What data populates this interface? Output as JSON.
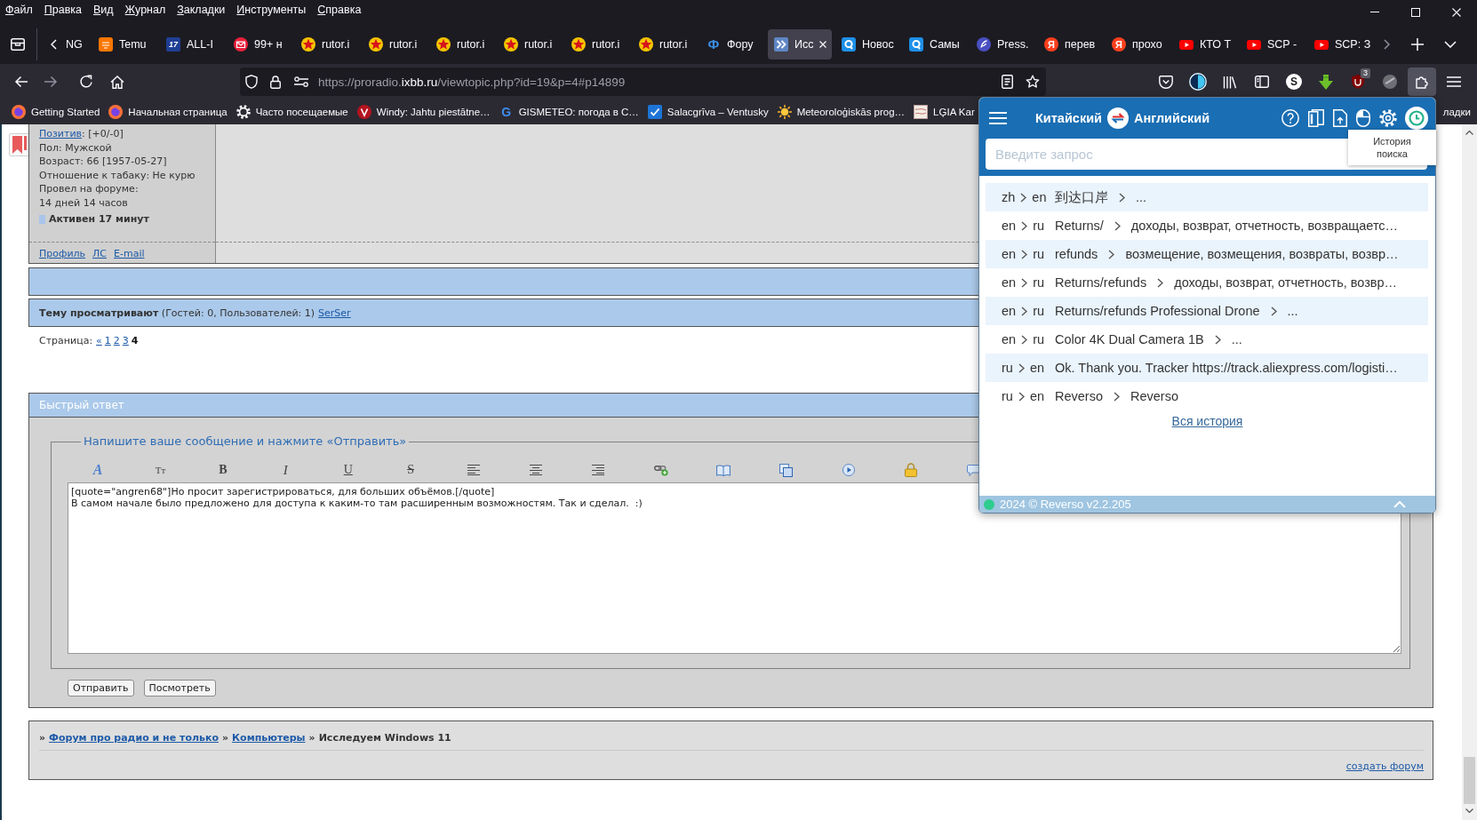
{
  "menu": [
    "Файл",
    "Правка",
    "Вид",
    "Журнал",
    "Закладки",
    "Инструменты",
    "Справка"
  ],
  "tabs": [
    {
      "title": "NG",
      "kind": "none",
      "selected": false
    },
    {
      "title": "Temu",
      "kind": "tile",
      "selected": false
    },
    {
      "title": "ALL-I",
      "kind": "number",
      "icon_text": "17",
      "selected": false
    },
    {
      "title": "99+ н",
      "kind": "mail",
      "selected": false
    },
    {
      "title": "rutor.i",
      "kind": "star",
      "selected": false
    },
    {
      "title": "rutor.i",
      "kind": "star",
      "selected": false
    },
    {
      "title": "rutor.i",
      "kind": "star",
      "selected": false
    },
    {
      "title": "rutor.i",
      "kind": "star",
      "selected": false
    },
    {
      "title": "rutor.i",
      "kind": "star",
      "selected": false
    },
    {
      "title": "rutor.i",
      "kind": "star",
      "selected": false
    },
    {
      "title": "Фору",
      "kind": "glyph",
      "icon_text": "Ф",
      "selected": false
    },
    {
      "title": "Исс",
      "kind": "arrows",
      "selected": true
    },
    {
      "title": "Новос",
      "kind": "ring",
      "selected": false
    },
    {
      "title": "Самы",
      "kind": "ring",
      "selected": false
    },
    {
      "title": "Press.",
      "kind": "feather",
      "selected": false
    },
    {
      "title": "перев",
      "kind": "round_letter",
      "icon_text": "Я",
      "selected": false
    },
    {
      "title": "прохо",
      "kind": "round_letter",
      "icon_text": "Я",
      "selected": false
    },
    {
      "title": "КТО Т",
      "kind": "play",
      "selected": false
    },
    {
      "title": "SCP -",
      "kind": "play",
      "selected": false
    },
    {
      "title": "SCP: З",
      "kind": "play",
      "selected": false
    }
  ],
  "navigation": {
    "back_disabled": false,
    "forward_disabled": true
  },
  "url": {
    "prefix": "https://proradio.",
    "domain": "ixbb.ru",
    "path": "/viewtopic.php?id=19&p=4#p14899"
  },
  "toolbar": {
    "extension_letter": "S",
    "blocker_badge": "3",
    "extensions_open": true
  },
  "bookmarks": [
    {
      "label": "Getting Started",
      "kind": "logo"
    },
    {
      "label": "Начальная страница",
      "kind": "logo"
    },
    {
      "label": "Часто посещаемые",
      "kind": "gear"
    },
    {
      "label": "Windy: Jahtu piestātne…",
      "kind": "vmark"
    },
    {
      "label": "GISMETEO: погода в С…",
      "kind": "letter",
      "icon_text": "G"
    },
    {
      "label": "Salacgrīva – Ventusky",
      "kind": "check"
    },
    {
      "label": "Meteoroloģiskās prog…",
      "kind": "sun"
    },
    {
      "label": "LĢIA Kar",
      "kind": "map"
    }
  ],
  "bookmarks_folder": "ладки",
  "post_author": {
    "reputation_link": "Позитив",
    "reputation_value": ": [+0/-0]",
    "details": [
      "Пол: Мужской",
      "Возраст: 66 [1957-05-27]",
      "Отношение к табаку: Не курю",
      "Провел на форуме:",
      "14 дней 14 часов"
    ],
    "activity": "Активен 17 минут",
    "links": [
      "Профиль",
      "ЛС",
      "E-mail"
    ]
  },
  "viewers": {
    "text": "**Тему просматривают** (Гостей: 0, Пользователей: 1)",
    "users": [
      "SerSer"
    ]
  },
  "pagination": {
    "label": "Страница:",
    "pages": [
      {
        "label": "«",
        "selected": false
      },
      {
        "label": "1",
        "selected": false
      },
      {
        "label": "2",
        "selected": false
      },
      {
        "label": "3",
        "selected": false
      },
      {
        "label": "4",
        "selected": true
      }
    ]
  },
  "quick_reply": {
    "title": "Быстрый ответ",
    "legend": "Напишите ваше сообщение и нажмите «Отправить»",
    "toolbar": [
      {
        "kind": "font-color",
        "text": "A"
      },
      {
        "kind": "font-size",
        "text": "Tт"
      },
      {
        "kind": "bold",
        "text": "B"
      },
      {
        "kind": "italic",
        "text": "I"
      },
      {
        "kind": "underline",
        "text": "U"
      },
      {
        "kind": "strike",
        "text": "S"
      },
      {
        "kind": "align-left"
      },
      {
        "kind": "align-center"
      },
      {
        "kind": "align-right"
      },
      {
        "kind": "link"
      },
      {
        "kind": "book"
      },
      {
        "kind": "windows"
      },
      {
        "kind": "video"
      },
      {
        "kind": "lock"
      },
      {
        "kind": "comment"
      }
    ],
    "message": "[quote=\"angren68\"]Но просит зарегистрироваться, для больших объёмов.[/quote]\nВ самом начале было предложено для доступа к каким-то там расширенным возможностям. Так и сделал.  :)",
    "buttons": [
      "Отправить",
      "Посмотреть"
    ]
  },
  "footer": {
    "separator": "»",
    "breadcrumbs": [
      {
        "label": "Форум про радио и не только",
        "kind": "link"
      },
      {
        "label": "Компьютеры",
        "kind": "link"
      },
      {
        "label": "Исследуем Windows 11",
        "kind": "current"
      }
    ],
    "create_forum_link": "создать форум"
  },
  "translator": {
    "source_language": "Китайский",
    "target_language": "Английский",
    "header_buttons": [
      {
        "kind": "help",
        "selected": false
      },
      {
        "kind": "book",
        "selected": false
      },
      {
        "kind": "upload",
        "selected": false
      },
      {
        "kind": "mouse",
        "selected": false
      },
      {
        "kind": "settings",
        "selected": false
      },
      {
        "kind": "history",
        "selected": true
      }
    ],
    "search_placeholder": "Введите запрос",
    "tooltip": "История поиска",
    "history": [
      {
        "from": "zh",
        "to": "en",
        "query": "到达口岸",
        "result": "..."
      },
      {
        "from": "en",
        "to": "ru",
        "query": "Returns/",
        "result": "доходы, возврат, отчетность, возвращаетс…"
      },
      {
        "from": "en",
        "to": "ru",
        "query": "refunds",
        "result": "возмещение, возмещения, возвраты, возвр…"
      },
      {
        "from": "en",
        "to": "ru",
        "query": "Returns/refunds",
        "result": "доходы, возврат, отчетность, возвр…"
      },
      {
        "from": "en",
        "to": "ru",
        "query": "Returns/refunds Professional Drone",
        "result": "..."
      },
      {
        "from": "en",
        "to": "ru",
        "query": "Color 4K Dual Camera 1B",
        "result": "..."
      },
      {
        "from": "ru",
        "to": "en",
        "query": "Ok. Thank you. Tracker https://track.aliexpress.com/logisti…"
      },
      {
        "from": "ru",
        "to": "en",
        "query": "Reverso",
        "result": "Reverso"
      }
    ],
    "all_history_link": "Вся история",
    "footer": "2024 © Reverso v2.2.205"
  }
}
